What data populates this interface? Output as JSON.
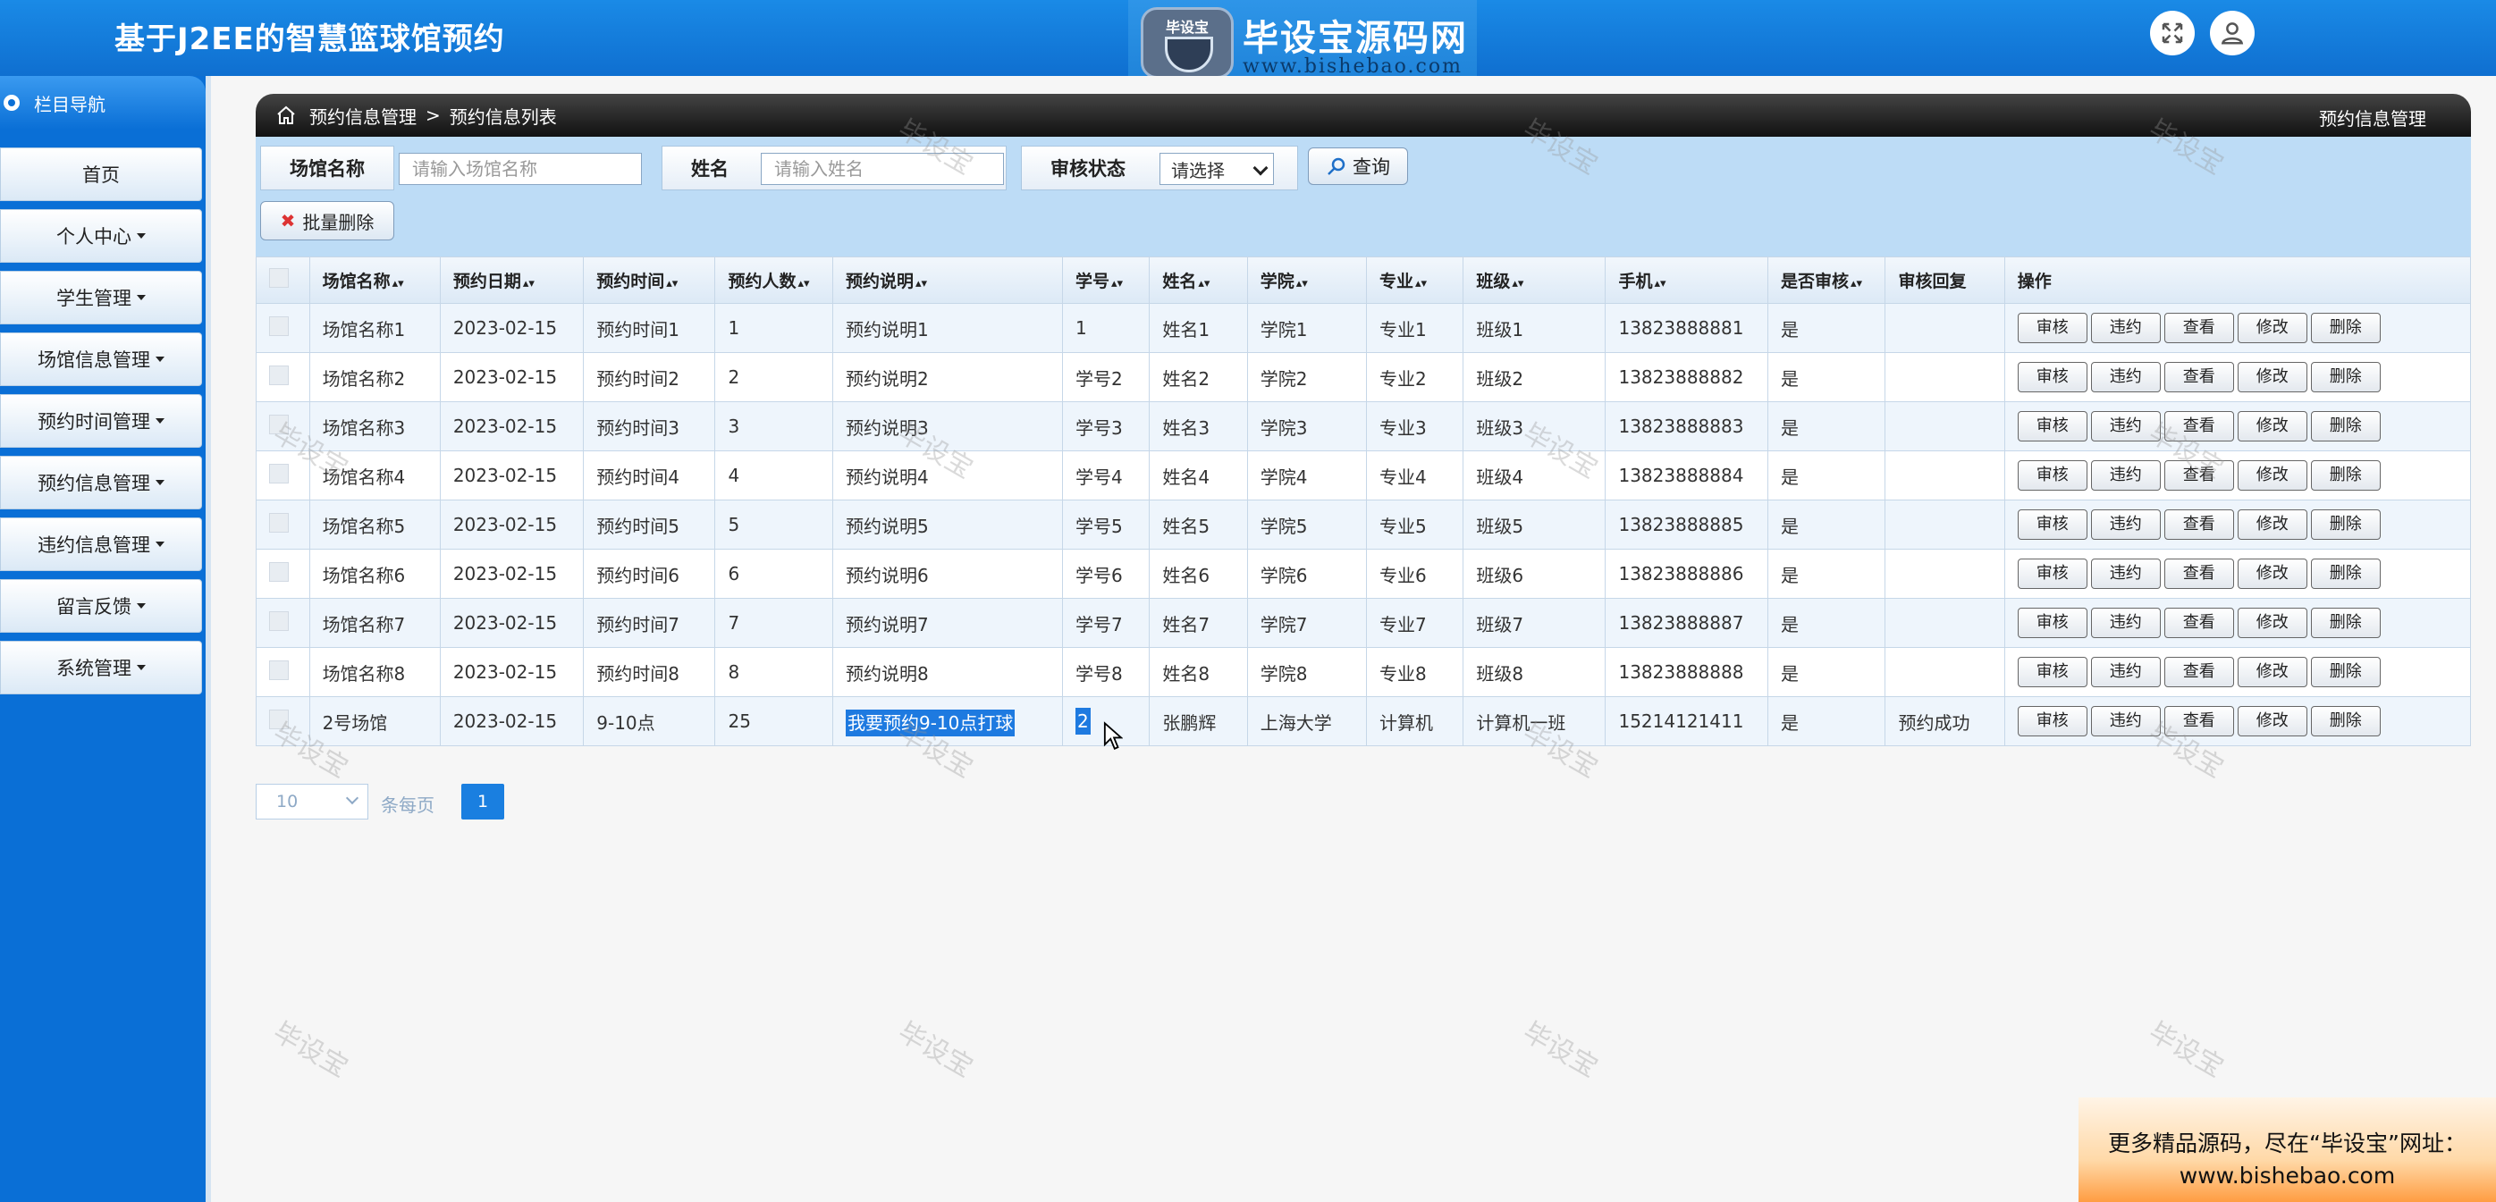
{
  "header": {
    "app_title": "基于J2EE的智慧篮球馆预约",
    "logo_badge": "毕设宝",
    "logo_name": "毕设宝源码网",
    "logo_url": "www.bishebao.com",
    "icons": [
      "fullscreen-icon",
      "user-icon"
    ]
  },
  "sidebar": {
    "title": "栏目导航",
    "items": [
      {
        "label": "首页",
        "has_caret": false
      },
      {
        "label": "个人中心",
        "has_caret": true
      },
      {
        "label": "学生管理",
        "has_caret": true
      },
      {
        "label": "场馆信息管理",
        "has_caret": true
      },
      {
        "label": "预约时间管理",
        "has_caret": true
      },
      {
        "label": "预约信息管理",
        "has_caret": true
      },
      {
        "label": "违约信息管理",
        "has_caret": true
      },
      {
        "label": "留言反馈",
        "has_caret": true
      },
      {
        "label": "系统管理",
        "has_caret": true
      }
    ]
  },
  "breadcrumb": {
    "section": "预约信息管理",
    "separator": ">",
    "page": "预约信息列表",
    "right_title": "预约信息管理"
  },
  "search": {
    "venue_label": "场馆名称",
    "venue_placeholder": "请输入场馆名称",
    "name_label": "姓名",
    "name_placeholder": "请输入姓名",
    "status_label": "审核状态",
    "status_value": "请选择",
    "query_label": "查询",
    "batch_delete_label": "批量删除"
  },
  "table": {
    "columns": [
      "场馆名称",
      "预约日期",
      "预约时间",
      "预约人数",
      "预约说明",
      "学号",
      "姓名",
      "学院",
      "专业",
      "班级",
      "手机",
      "是否审核",
      "审核回复",
      "操作"
    ],
    "actions": [
      "审核",
      "违约",
      "查看",
      "修改",
      "删除"
    ],
    "rows": [
      [
        "场馆名称1",
        "2023-02-15",
        "预约时间1",
        "1",
        "预约说明1",
        "1",
        "姓名1",
        "学院1",
        "专业1",
        "班级1",
        "13823888881",
        "是",
        ""
      ],
      [
        "场馆名称2",
        "2023-02-15",
        "预约时间2",
        "2",
        "预约说明2",
        "学号2",
        "姓名2",
        "学院2",
        "专业2",
        "班级2",
        "13823888882",
        "是",
        ""
      ],
      [
        "场馆名称3",
        "2023-02-15",
        "预约时间3",
        "3",
        "预约说明3",
        "学号3",
        "姓名3",
        "学院3",
        "专业3",
        "班级3",
        "13823888883",
        "是",
        ""
      ],
      [
        "场馆名称4",
        "2023-02-15",
        "预约时间4",
        "4",
        "预约说明4",
        "学号4",
        "姓名4",
        "学院4",
        "专业4",
        "班级4",
        "13823888884",
        "是",
        ""
      ],
      [
        "场馆名称5",
        "2023-02-15",
        "预约时间5",
        "5",
        "预约说明5",
        "学号5",
        "姓名5",
        "学院5",
        "专业5",
        "班级5",
        "13823888885",
        "是",
        ""
      ],
      [
        "场馆名称6",
        "2023-02-15",
        "预约时间6",
        "6",
        "预约说明6",
        "学号6",
        "姓名6",
        "学院6",
        "专业6",
        "班级6",
        "13823888886",
        "是",
        ""
      ],
      [
        "场馆名称7",
        "2023-02-15",
        "预约时间7",
        "7",
        "预约说明7",
        "学号7",
        "姓名7",
        "学院7",
        "专业7",
        "班级7",
        "13823888887",
        "是",
        ""
      ],
      [
        "场馆名称8",
        "2023-02-15",
        "预约时间8",
        "8",
        "预约说明8",
        "学号8",
        "姓名8",
        "学院8",
        "专业8",
        "班级8",
        "13823888888",
        "是",
        ""
      ],
      [
        "2号场馆",
        "2023-02-15",
        "9-10点",
        "25",
        "我要预约9-10点打球",
        "2",
        "张鹏辉",
        "上海大学",
        "计算机",
        "计算机一班",
        "15214121411",
        "是",
        "预约成功"
      ]
    ]
  },
  "pagination": {
    "per_page_value": "10",
    "per_page_label": "条每页",
    "current_page": "1"
  },
  "watermark_text": "毕设宝",
  "promo": {
    "line1": "更多精品源码，尽在“毕设宝”网址：",
    "line2": "www.bishebao.com"
  },
  "colors": {
    "header_blue": "#0f6fd0",
    "sidebar_blue": "#0a6fd6",
    "accent": "#1a7fe0"
  }
}
